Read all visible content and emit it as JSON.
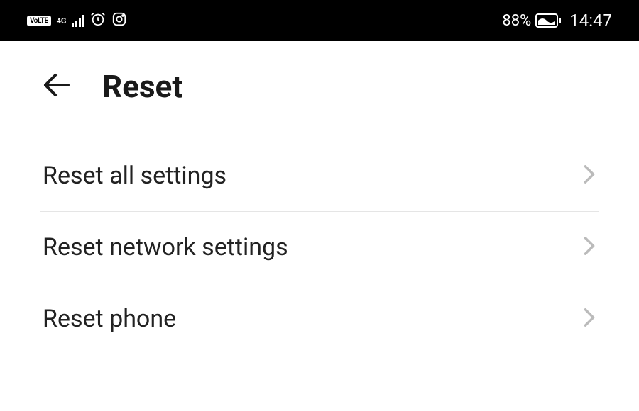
{
  "statusBar": {
    "volte": "VoLTE",
    "network": "4G",
    "battery": "88%",
    "time": "14:47"
  },
  "header": {
    "title": "Reset"
  },
  "items": [
    {
      "label": "Reset all settings"
    },
    {
      "label": "Reset network settings"
    },
    {
      "label": "Reset phone"
    }
  ]
}
